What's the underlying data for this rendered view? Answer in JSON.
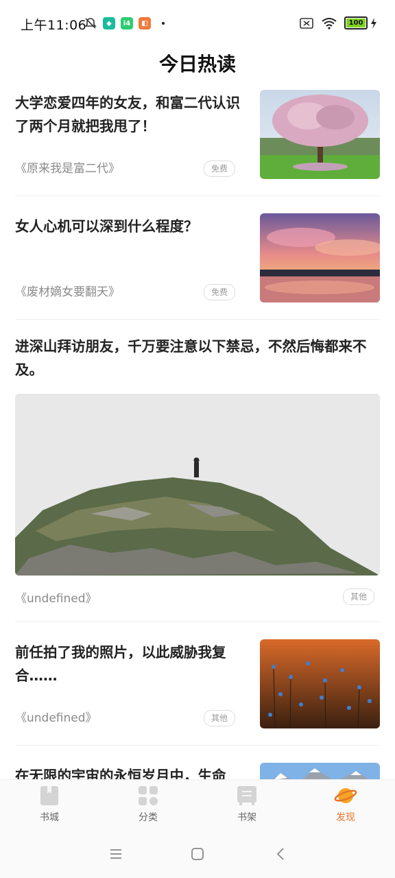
{
  "status": {
    "time": "上午11:06",
    "battery": "100"
  },
  "page": {
    "title": "今日热读"
  },
  "articles": [
    {
      "title": "大学恋爱四年的女友，和富二代认识了两个月就把我甩了！",
      "source": "《原来我是富二代》",
      "tag": "免费"
    },
    {
      "title": "女人心机可以深到什么程度？",
      "source": "《废材嫡女要翻天》",
      "tag": "免费"
    },
    {
      "title": "进深山拜访朋友，千万要注意以下禁忌，不然后悔都来不及。",
      "source": "《undefined》",
      "tag": "其他"
    },
    {
      "title": "前任拍了我的照片，以此威胁我复合……",
      "source": "《undefined》",
      "tag": "其他"
    },
    {
      "title": "在无限的宇宙的永恒岁月中，生命"
    }
  ],
  "nav": {
    "items": [
      {
        "label": "书城",
        "icon": "bookstore-icon"
      },
      {
        "label": "分类",
        "icon": "category-icon"
      },
      {
        "label": "书架",
        "icon": "bookshelf-icon"
      },
      {
        "label": "发现",
        "icon": "planet-icon"
      }
    ],
    "active_color": "#e8742a"
  }
}
